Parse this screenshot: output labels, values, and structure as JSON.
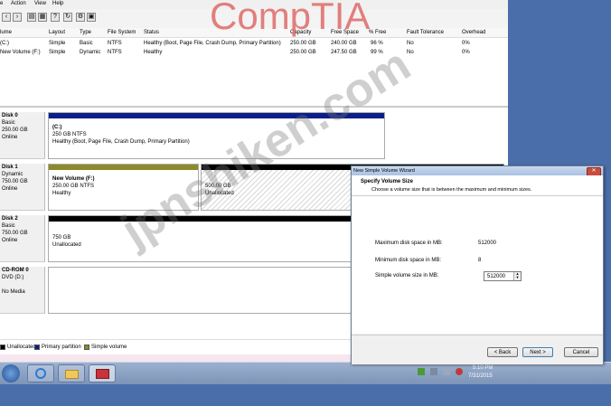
{
  "menu": {
    "items": [
      "Action",
      "View",
      "Help"
    ]
  },
  "volume_table": {
    "headers": [
      "lume",
      "Layout",
      "Type",
      "File System",
      "Status",
      "Capacity",
      "Free Space",
      "% Free",
      "Fault Tolerance",
      "Overhead"
    ],
    "rows": [
      [
        "(C:)",
        "Simple",
        "Basic",
        "NTFS",
        "Healthy (Boot, Page File, Crash Dump, Primary Partition)",
        "250.00 GB",
        "240.00 GB",
        "96 %",
        "No",
        "0%"
      ],
      [
        "New Volume (F:)",
        "Simple",
        "Dynamic",
        "NTFS",
        "Healthy",
        "250.00 GB",
        "247.50 GB",
        "99 %",
        "No",
        "0%"
      ]
    ]
  },
  "disks": [
    {
      "name": "Disk 0",
      "type": "Basic",
      "size": "250.00 GB",
      "state": "Online",
      "parts": [
        {
          "title": "(C:)",
          "line2": "250 GB NTFS",
          "line3": "Healthy (Boot, Page File, Crash Dump, Primary Partition)"
        }
      ]
    },
    {
      "name": "Disk 1",
      "type": "Dynamic",
      "size": "750.00 GB",
      "state": "Online",
      "parts": [
        {
          "title": "New Volume (F:)",
          "line2": "250.00 GB NTFS",
          "line3": "Healthy"
        },
        {
          "title": "",
          "line2": "500.00 GB",
          "line3": "Unallocated"
        }
      ]
    },
    {
      "name": "Disk 2",
      "type": "Basic",
      "size": "750.00 GB",
      "state": "Online",
      "parts": [
        {
          "title": "",
          "line2": "750 GB",
          "line3": "Unallocated"
        }
      ]
    },
    {
      "name": "CD-ROM 0",
      "type": "DVD (D:)",
      "size": "",
      "state": "No Media",
      "parts": []
    }
  ],
  "legend": {
    "unallocated": "Unallocated",
    "primary": "Primary partition",
    "simple": "Simple volume"
  },
  "wizard": {
    "title": "New Simple Volume Wizard",
    "heading": "Specify Volume Size",
    "subheading": "Choose a volume size that is between the maximum and minimum sizes.",
    "max_label": "Maximum disk space in MB:",
    "max_value": "512000",
    "min_label": "Minimum disk space in MB:",
    "min_value": "8",
    "size_label": "Simple volume size in MB:",
    "size_value": "512000",
    "back": "< Back",
    "next": "Next >",
    "cancel": "Cancel"
  },
  "taskbar": {
    "time": "5:10 PM",
    "date": "7/31/2015"
  },
  "watermarks": {
    "brand": "CompTIA",
    "site": "jpnshiken.com"
  },
  "colors": {
    "primary_partition": "#0a1f8a",
    "simple_volume": "#8c8a2a",
    "unallocated": "#000000"
  }
}
